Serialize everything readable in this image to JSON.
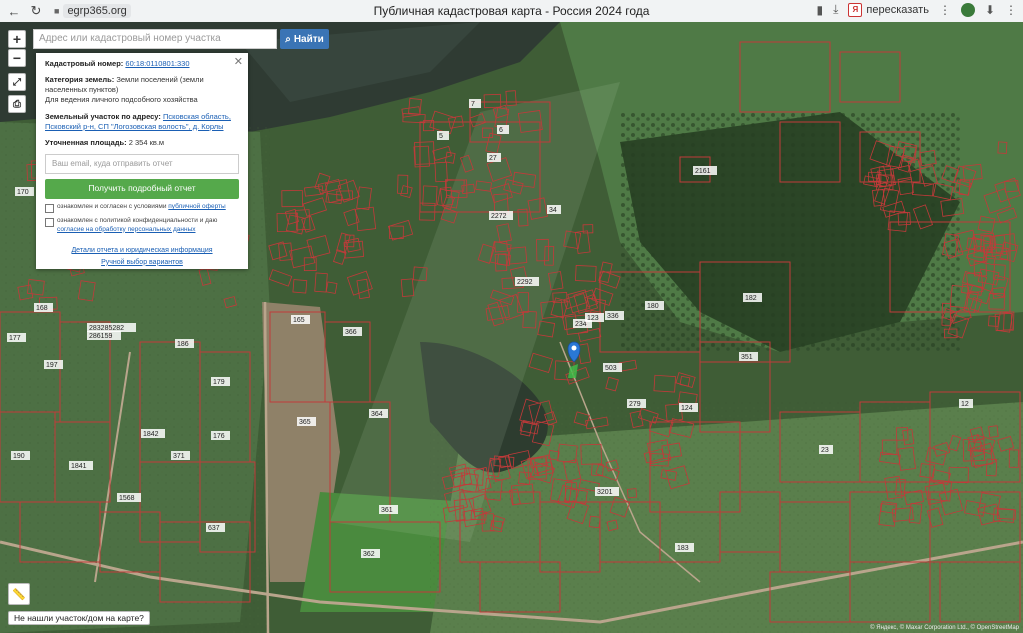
{
  "browser": {
    "back_icon": "back-arrow-icon",
    "reload_icon": "reload-icon",
    "domain": "egrp365.org",
    "title": "Публичная кадастровая карта - Россия 2024 года",
    "retell_label": "пересказать",
    "retell_badge": "Я"
  },
  "map_controls": {
    "zoom_in": "+",
    "zoom_out": "−",
    "fullscreen_icon": "expand-icon",
    "print_icon": "print-icon",
    "ruler_icon": "ruler-icon"
  },
  "search": {
    "placeholder": "Адрес или кадастровый номер участка",
    "button_label": "Найти"
  },
  "info_panel": {
    "cadastral_label": "Кадастровый номер:",
    "cadastral_value": "60:18:0110801:330",
    "category_label": "Категория земель:",
    "category_value": "Земли поселений (земли населенных пунктов)",
    "usage_value": "Для ведения личного подсобного хозяйства",
    "address_label": "Земельный участок по адресу:",
    "address_value": "Псковская область, Псковский р-н, СП \"Логозовская волость\", д. Корлы",
    "area_label": "Уточненная площадь:",
    "area_value": "2 354 кв.м",
    "email_placeholder": "Ваш email, куда отправить отчет",
    "report_button": "Получить подробный отчет",
    "consent1_text": "ознакомлен и согласен с условиями",
    "consent1_link": "публичной оферты",
    "consent2_text": "ознакомлен с политикой конфиденциальности и даю",
    "consent2_link": "согласие на обработку персональных данных",
    "link_details": "Детали отчета и юридическая информация",
    "link_manual": "Ручной выбор вариантов"
  },
  "bottom": {
    "not_found": "Не нашли участок/дом на карте?",
    "attribution": "© Яндекс, © Maxar Corporation Ltd., © OpenStreetMap"
  },
  "parcel_labels": [
    {
      "t": "168"
    },
    {
      "t": "177"
    },
    {
      "t": "197"
    },
    {
      "t": "190"
    },
    {
      "t": "1841"
    },
    {
      "t": "1568"
    },
    {
      "t": "176"
    },
    {
      "t": "371"
    },
    {
      "t": "179"
    },
    {
      "t": "637"
    },
    {
      "t": "361"
    },
    {
      "t": "362"
    },
    {
      "t": "364"
    },
    {
      "t": "365"
    },
    {
      "t": "165"
    },
    {
      "t": "366"
    },
    {
      "t": "180"
    },
    {
      "t": "182"
    },
    {
      "t": "351"
    },
    {
      "t": "183"
    },
    {
      "t": "2161"
    },
    {
      "t": "124"
    },
    {
      "t": "503"
    },
    {
      "t": "279"
    },
    {
      "t": "3201"
    },
    {
      "t": "234"
    },
    {
      "t": "2292"
    },
    {
      "t": "2272"
    },
    {
      "t": "34"
    },
    {
      "t": "336"
    },
    {
      "t": "123"
    },
    {
      "t": "7"
    },
    {
      "t": "5"
    },
    {
      "t": "6"
    },
    {
      "t": "27"
    },
    {
      "t": "170"
    },
    {
      "t": "283285282"
    },
    {
      "t": "286159"
    },
    {
      "t": "186"
    },
    {
      "t": "1842"
    },
    {
      "t": "23"
    },
    {
      "t": "12"
    }
  ]
}
